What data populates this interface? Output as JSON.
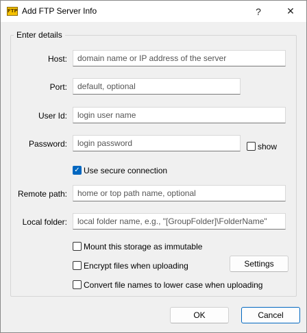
{
  "window": {
    "title": "Add FTP Server Info",
    "icon_text": "FTP",
    "help_glyph": "?",
    "close_glyph": "✕"
  },
  "group": {
    "legend": "Enter details"
  },
  "fields": {
    "host": {
      "label": "Host:",
      "value": "",
      "placeholder": "domain name or IP address of the server"
    },
    "port": {
      "label": "Port:",
      "value": "",
      "placeholder": "default, optional"
    },
    "user_id": {
      "label": "User Id:",
      "value": "",
      "placeholder": "login user name"
    },
    "password": {
      "label": "Password:",
      "value": "",
      "placeholder": "login password"
    },
    "remote_path": {
      "label": "Remote path:",
      "value": "",
      "placeholder": "home or top path name, optional"
    },
    "local_folder": {
      "label": "Local folder:",
      "value": "",
      "placeholder": "local folder name, e.g., \"[GroupFolder]\\FolderName\""
    }
  },
  "options": {
    "show_password": {
      "label": "show",
      "checked": false
    },
    "secure": {
      "label": "Use secure connection",
      "checked": true,
      "check_glyph": "✓"
    },
    "immutable": {
      "label": "Mount this storage as immutable",
      "checked": false
    },
    "encrypt": {
      "label": "Encrypt files when uploading",
      "checked": false
    },
    "lowercase": {
      "label": "Convert file names to lower case when uploading",
      "checked": false
    }
  },
  "buttons": {
    "settings": "Settings",
    "ok": "OK",
    "cancel": "Cancel"
  }
}
